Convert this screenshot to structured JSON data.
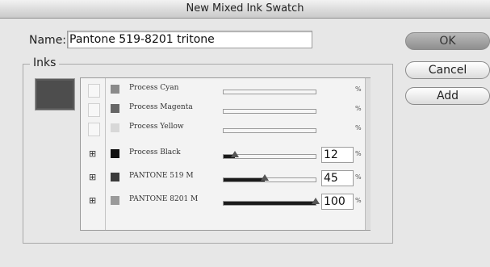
{
  "dialog": {
    "title": "New Mixed Ink Swatch"
  },
  "name": {
    "label": "Name:",
    "value": "Pantone 519-8201 tritone"
  },
  "buttons": {
    "ok": "OK",
    "cancel": "Cancel",
    "add": "Add"
  },
  "inks": {
    "legend": "Inks",
    "preview_color": "#4d4d4d",
    "rows": [
      {
        "name": "Process Cyan",
        "color": "#8a8a8a",
        "checked": false,
        "percent": "",
        "value": 0,
        "unit": "%"
      },
      {
        "name": "Process Magenta",
        "color": "#666666",
        "checked": false,
        "percent": "",
        "value": 0,
        "unit": "%"
      },
      {
        "name": "Process Yellow",
        "color": "#d8d8d8",
        "checked": false,
        "percent": "",
        "value": 0,
        "unit": "%"
      },
      {
        "name": "Process Black",
        "color": "#111111",
        "checked": true,
        "percent": "12",
        "value": 12,
        "unit": "%"
      },
      {
        "name": "PANTONE 519 M",
        "color": "#3a3a3a",
        "checked": true,
        "percent": "45",
        "value": 45,
        "unit": "%"
      },
      {
        "name": "PANTONE 8201 M",
        "color": "#9a9a9a",
        "checked": true,
        "percent": "100",
        "value": 100,
        "unit": "%"
      }
    ]
  }
}
